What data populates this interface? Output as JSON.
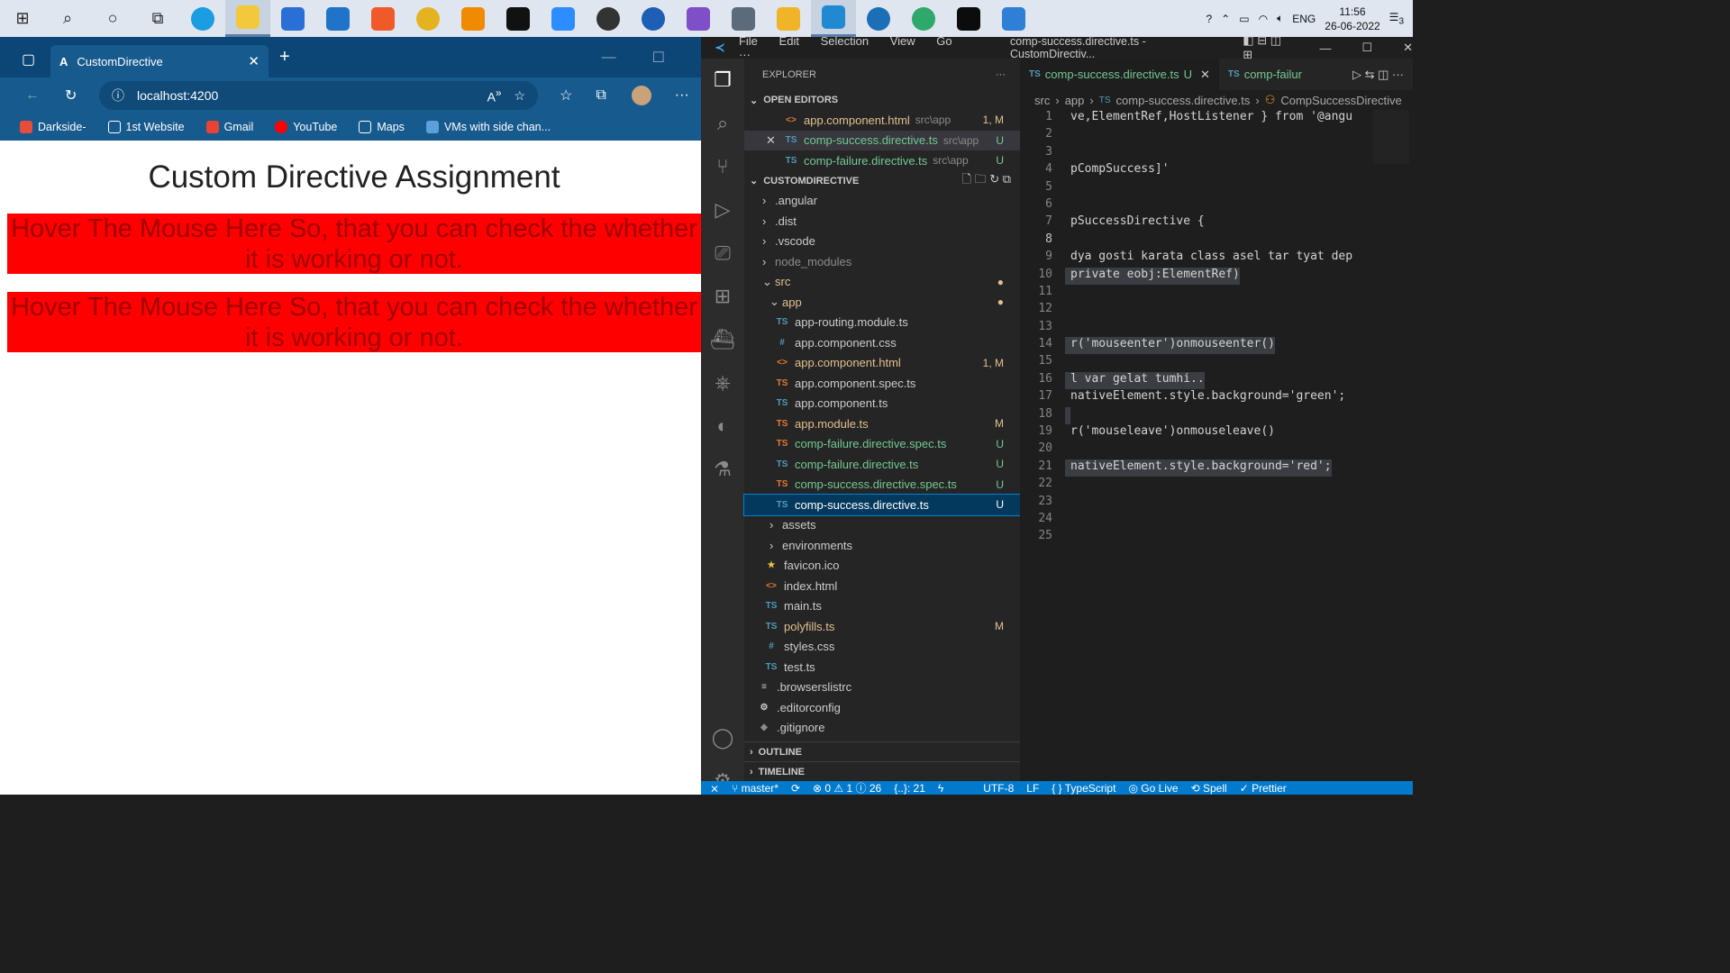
{
  "taskbar": {
    "time": "11:56",
    "date": "26-06-2022",
    "lang": "ENG",
    "notifications": "3"
  },
  "browser": {
    "tab_title": "CustomDirective",
    "url": "localhost:4200",
    "bookmarks": [
      "Darkside-",
      "1st Website",
      "Gmail",
      "YouTube",
      "Maps",
      "VMs with side chan..."
    ],
    "page": {
      "heading": "Custom Directive Assignment",
      "box1": "Hover The Mouse Here So, that you can check the whether it is working or not.",
      "box2": "Hover The Mouse Here So, that you can check the whether it is working or not."
    }
  },
  "vscode": {
    "menu": [
      "File",
      "Edit",
      "Selection",
      "View",
      "Go",
      "···"
    ],
    "window_title": "comp-success.directive.ts - CustomDirectiv...",
    "explorer_label": "EXPLORER",
    "open_editors_label": "OPEN EDITORS",
    "open_editors": [
      {
        "name": "app.component.html",
        "path": "src\\app",
        "status": "1, M"
      },
      {
        "name": "comp-success.directive.ts",
        "path": "src\\app",
        "status": "U"
      },
      {
        "name": "comp-failure.directive.ts",
        "path": "src\\app",
        "status": "U"
      }
    ],
    "project_label": "CUSTOMDIRECTIVE",
    "tree": {
      "angular": ".angular",
      "dist": ".dist",
      "vscode": ".vscode",
      "node_modules": "node_modules",
      "src": "src",
      "app": "app",
      "files": [
        {
          "name": "app-routing.module.ts",
          "status": ""
        },
        {
          "name": "app.component.css",
          "status": ""
        },
        {
          "name": "app.component.html",
          "status": "1, M"
        },
        {
          "name": "app.component.spec.ts",
          "status": ""
        },
        {
          "name": "app.component.ts",
          "status": ""
        },
        {
          "name": "app.module.ts",
          "status": "M"
        },
        {
          "name": "comp-failure.directive.spec.ts",
          "status": "U"
        },
        {
          "name": "comp-failure.directive.ts",
          "status": "U"
        },
        {
          "name": "comp-success.directive.spec.ts",
          "status": "U"
        },
        {
          "name": "comp-success.directive.ts",
          "status": "U"
        }
      ],
      "assets": "assets",
      "environments": "environments",
      "favicon": "favicon.ico",
      "index": "index.html",
      "main": "main.ts",
      "polyfills": "polyfills.ts",
      "polyfills_status": "M",
      "styles": "styles.css",
      "test": "test.ts",
      "browserslistrc": ".browserslistrc",
      "editorconfig": ".editorconfig",
      "gitignore": ".gitignore"
    },
    "outline_label": "OUTLINE",
    "timeline_label": "TIMELINE",
    "tabs": [
      {
        "label": "comp-success.directive.ts",
        "status": "U"
      },
      {
        "label": "comp-failur"
      }
    ],
    "breadcrumb": [
      "src",
      "app",
      "comp-success.directive.ts",
      "CompSuccessDirective"
    ],
    "code_lines": [
      "ve,ElementRef,HostListener } from '@angu",
      "",
      "",
      "pCompSuccess]'",
      "",
      "",
      "pSuccessDirective {",
      "",
      "dya gosti karata class asel tar tyat dep",
      "private eobj:ElementRef)",
      "",
      "",
      "",
      "r('mouseenter')onmouseenter()",
      "",
      "l var gelat tumhi..",
      "nativeElement.style.background='green';",
      "",
      "r('mouseleave')onmouseleave()",
      "",
      "nativeElement.style.background='red';",
      "",
      "",
      "",
      ""
    ],
    "status": {
      "branch": "master*",
      "problems": "⊗ 0 ⚠ 1 ⓘ 26",
      "braces": "{..}: 21",
      "encoding": "UTF-8",
      "eol": "LF",
      "language": "{ } TypeScript",
      "golive": "Go Live",
      "spell": "Spell",
      "prettier": "Prettier"
    }
  }
}
